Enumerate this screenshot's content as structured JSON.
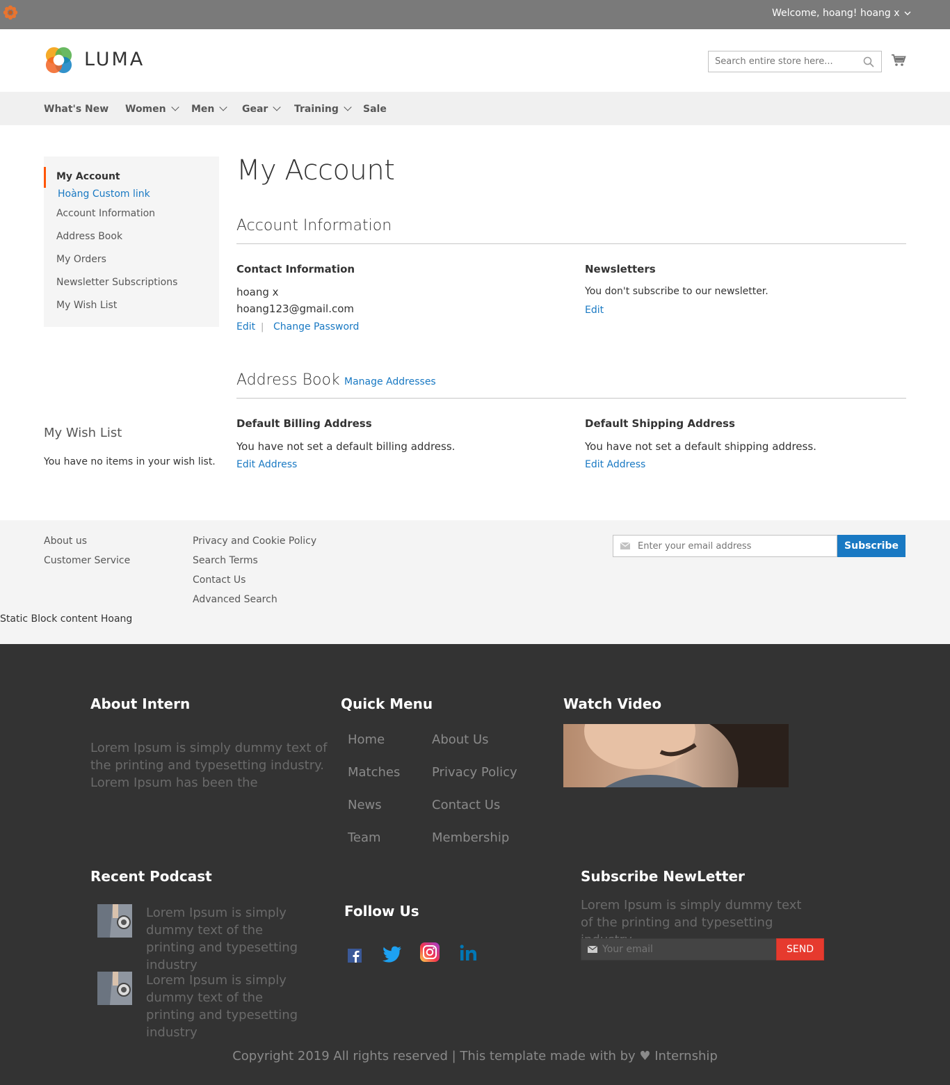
{
  "topbar": {
    "welcome": "Welcome, hoang!",
    "user_menu": "hoang x"
  },
  "header": {
    "logo_text": "LUMA",
    "search_placeholder": "Search entire store here...",
    "icons": {
      "search": "search-icon",
      "cart": "cart-icon",
      "logo": "luma-logo-icon",
      "plugin": "flower-icon"
    }
  },
  "nav": {
    "items": [
      {
        "label": "What's New",
        "has_dropdown": false
      },
      {
        "label": "Women",
        "has_dropdown": true
      },
      {
        "label": "Men",
        "has_dropdown": true
      },
      {
        "label": "Gear",
        "has_dropdown": true
      },
      {
        "label": "Training",
        "has_dropdown": true
      },
      {
        "label": "Sale",
        "has_dropdown": false
      }
    ]
  },
  "sidebar": {
    "items": [
      {
        "label": "My Account",
        "state": "current"
      },
      {
        "label": "Hoàng Custom link",
        "state": "link"
      },
      {
        "label": "Account Information",
        "state": "normal"
      },
      {
        "label": "Address Book",
        "state": "normal"
      },
      {
        "label": "My Orders",
        "state": "normal"
      },
      {
        "label": "Newsletter Subscriptions",
        "state": "normal"
      },
      {
        "label": "My Wish List",
        "state": "normal"
      }
    ],
    "wishlist": {
      "title": "My Wish List",
      "text": "You have no items in your wish list."
    }
  },
  "main": {
    "page_title": "My Account",
    "account_info": {
      "title": "Account Information",
      "contact": {
        "title": "Contact Information",
        "name": "hoang x",
        "email": "hoang123@gmail.com",
        "edit": "Edit",
        "separator": "|",
        "change_password": "Change Password"
      },
      "newsletters": {
        "title": "Newsletters",
        "text": "You don't subscribe to our newsletter.",
        "edit": "Edit"
      }
    },
    "address_book": {
      "title": "Address Book",
      "manage": "Manage Addresses",
      "billing": {
        "title": "Default Billing Address",
        "text": "You have not set a default billing address.",
        "edit": "Edit Address"
      },
      "shipping": {
        "title": "Default Shipping Address",
        "text": "You have not set a default shipping address.",
        "edit": "Edit Address"
      }
    }
  },
  "footer_light": {
    "col1": [
      "About us",
      "Customer Service"
    ],
    "col2": [
      "Privacy and Cookie Policy",
      "Search Terms",
      "Contact Us",
      "Advanced Search"
    ],
    "newsletter_placeholder": "Enter your email address",
    "subscribe": "Subscribe",
    "static_block": "Static Block content Hoang"
  },
  "footer_dark": {
    "about": {
      "title": "About Intern",
      "text": "Lorem Ipsum is simply dummy text of the printing and typesetting industry. Lorem Ipsum has been the"
    },
    "quick_menu": {
      "title": "Quick Menu",
      "col1": [
        "Home",
        "Matches",
        "News",
        "Team"
      ],
      "col2": [
        "About Us",
        "Privacy Policy",
        "Contact Us",
        "Membership"
      ]
    },
    "video": {
      "title": "Watch Video"
    },
    "podcast": {
      "title": "Recent Podcast",
      "items": [
        "Lorem Ipsum is simply dummy text of the printing and typesetting industry",
        "Lorem Ipsum is simply dummy text of the printing and typesetting industry"
      ]
    },
    "follow": {
      "title": "Follow Us",
      "icons": [
        "facebook-icon",
        "twitter-icon",
        "instagram-icon",
        "linkedin-icon"
      ]
    },
    "subscribe": {
      "title": "Subscribe NewLetter",
      "text": "Lorem Ipsum is simply dummy text of the printing and typesetting industry",
      "placeholder": "Your email",
      "button": "SEND"
    },
    "copyright": "Copyright 2019 All rights reserved | This template made with by ♥ Internship"
  },
  "colors": {
    "topbar": "#7a7a7a",
    "link": "#1979c3",
    "accent": "#ff5501",
    "dark_footer": "#333333",
    "send": "#e63a2e"
  }
}
